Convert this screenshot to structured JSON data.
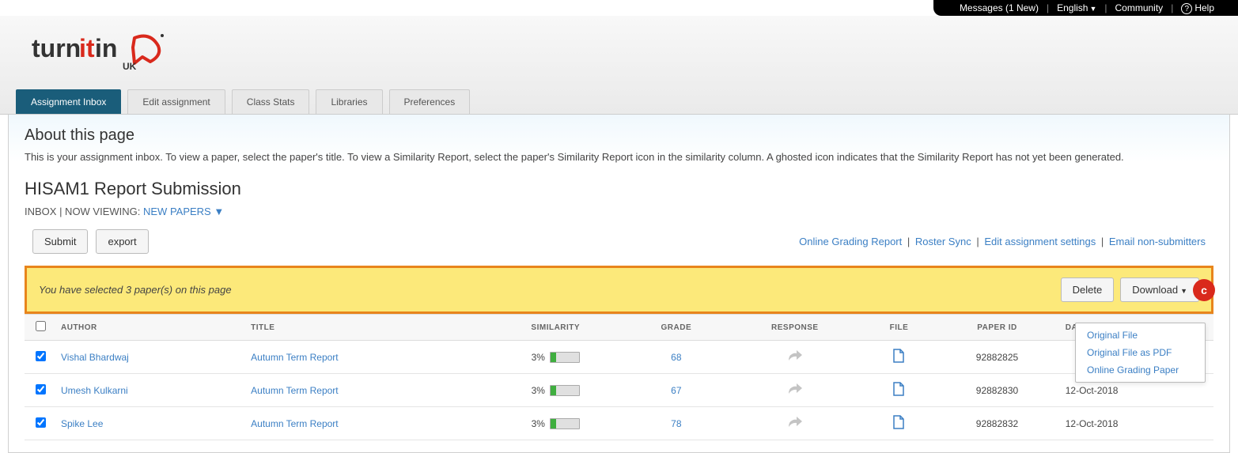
{
  "topbar": {
    "messages": "Messages (1 New)",
    "language": "English",
    "community": "Community",
    "help": "Help"
  },
  "logo": {
    "text_turn": "turn",
    "text_it": "it",
    "text_in": "in",
    "uk": "UK"
  },
  "tabs": [
    {
      "label": "Assignment Inbox",
      "active": true
    },
    {
      "label": "Edit assignment",
      "active": false
    },
    {
      "label": "Class Stats",
      "active": false
    },
    {
      "label": "Libraries",
      "active": false
    },
    {
      "label": "Preferences",
      "active": false
    }
  ],
  "about": {
    "heading": "About this page",
    "body": "This is your assignment inbox. To view a paper, select the paper's title. To view a Similarity Report, select the paper's Similarity Report icon in the similarity column. A ghosted icon indicates that the Similarity Report has not yet been generated."
  },
  "assignment": {
    "title": "HISAM1 Report Submission",
    "viewing_prefix": "INBOX | NOW VIEWING: ",
    "viewing_link": "NEW PAPERS ▼"
  },
  "actions": {
    "submit": "Submit",
    "export": "export",
    "links": {
      "grading": "Online Grading Report",
      "roster": "Roster Sync",
      "edit": "Edit assignment settings",
      "email": "Email non-submitters"
    }
  },
  "selection": {
    "text": "You have selected 3 paper(s) on this page",
    "delete": "Delete",
    "download": "Download",
    "badge": "c",
    "menu": {
      "original": "Original File",
      "pdf": "Original File as PDF",
      "grading": "Online Grading Paper"
    }
  },
  "table": {
    "headers": {
      "author": "AUTHOR",
      "title": "TITLE",
      "similarity": "SIMILARITY",
      "grade": "GRADE",
      "response": "RESPONSE",
      "file": "FILE",
      "paperid": "PAPER ID",
      "date": "DATE"
    },
    "rows": [
      {
        "checked": true,
        "author": "Vishal Bhardwaj",
        "title": "Autumn Term Report",
        "similarity": "3%",
        "sim_fill": 20,
        "grade": "68",
        "paperid": "92882825",
        "date": ""
      },
      {
        "checked": true,
        "author": "Umesh Kulkarni",
        "title": "Autumn Term Report",
        "similarity": "3%",
        "sim_fill": 20,
        "grade": "67",
        "paperid": "92882830",
        "date": "12-Oct-2018"
      },
      {
        "checked": true,
        "author": "Spike Lee",
        "title": "Autumn Term Report",
        "similarity": "3%",
        "sim_fill": 20,
        "grade": "78",
        "paperid": "92882832",
        "date": "12-Oct-2018"
      }
    ]
  }
}
